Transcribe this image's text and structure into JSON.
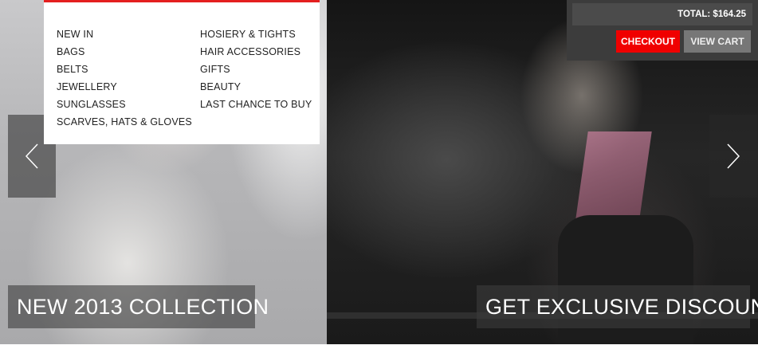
{
  "menu": {
    "column1": [
      "NEW IN",
      "BAGS",
      "BELTS",
      "JEWELLERY",
      "SUNGLASSES",
      "SCARVES, HATS & GLOVES"
    ],
    "column2": [
      "HOSIERY & TIGHTS",
      "HAIR ACCESSORIES",
      "GIFTS",
      "BEAUTY",
      "LAST CHANCE TO BUY"
    ],
    "accent_color": "#e41f1f"
  },
  "cart": {
    "total": "TOTAL: $164.25",
    "checkout_label": "CHECKOUT",
    "view_cart_label": "VIEW CART",
    "checkout_color": "#f00000"
  },
  "slider": {
    "left_caption": "NEW 2013 COLLECTION",
    "right_caption": "GET EXCLUSIVE DISCOUNT",
    "prev_icon": "chevron-left-icon",
    "next_icon": "chevron-right-icon"
  }
}
